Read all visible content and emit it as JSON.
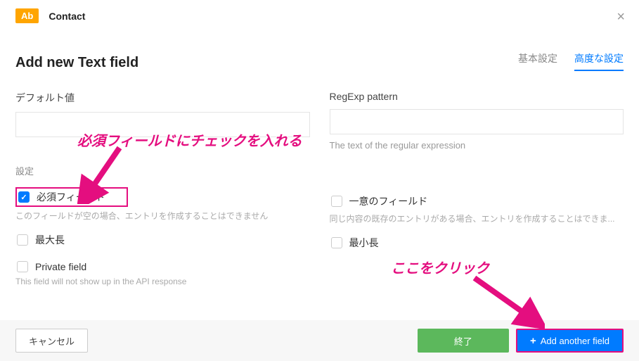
{
  "header": {
    "type_badge": "Ab",
    "type_name": "Contact"
  },
  "title": "Add new Text field",
  "tabs": {
    "basic": "基本設定",
    "advanced": "高度な設定"
  },
  "left_col": {
    "default_label": "デフォルト値",
    "settings_label": "設定",
    "required": {
      "label": "必須フィールド",
      "desc": "このフィールドが空の場合、エントリを作成することはできません"
    },
    "maxlen": {
      "label": "最大長"
    },
    "private": {
      "label": "Private field",
      "desc": "This field will not show up in the API response"
    }
  },
  "right_col": {
    "regexp_label": "RegExp pattern",
    "regexp_helper": "The text of the regular expression",
    "unique": {
      "label": "一意のフィールド",
      "desc": "同じ内容の既存のエントリがある場合、エントリを作成することはできま..."
    },
    "minlen": {
      "label": "最小長"
    }
  },
  "footer": {
    "cancel": "キャンセル",
    "finish": "終了",
    "add_another": "Add another field"
  },
  "annotations": {
    "anno1": "必須フィールドにチェックを入れる",
    "anno2": "ここをクリック"
  }
}
